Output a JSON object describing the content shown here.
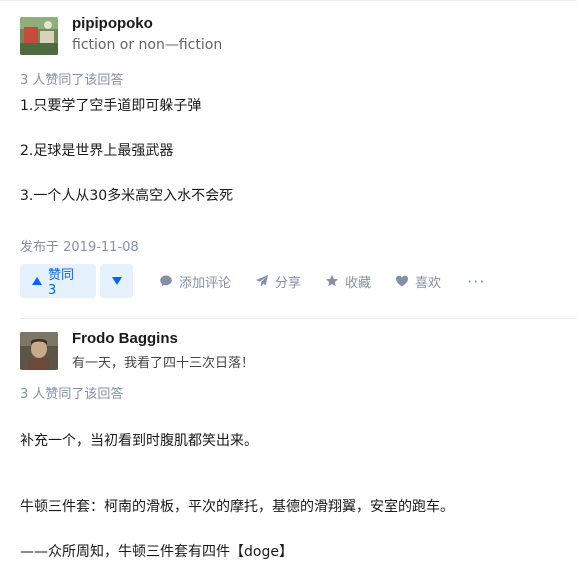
{
  "answers": [
    {
      "author": {
        "name": "pipipopoko",
        "bio": "fiction or non—fiction"
      },
      "votes_text": "3 人赞同了该回答",
      "paragraphs": [
        "1.只要学了空手道即可躲子弹",
        "2.足球是世界上最强武器",
        "3.一个人从30多米高空入水不会死"
      ],
      "published": "发布于 2019-11-08",
      "actions": {
        "upvote_label": "赞同 3",
        "comment_label": "添加评论",
        "share_label": "分享",
        "collect_label": "收藏",
        "like_label": "喜欢",
        "more_label": "···"
      }
    },
    {
      "author": {
        "name": "Frodo Baggins",
        "bio": "有一天，我看了四十三次日落！"
      },
      "votes_text": "3 人赞同了该回答",
      "paragraphs": [
        "补充一个，当初看到时腹肌都笑出来。",
        "牛顿三件套：柯南的滑板，平次的摩托，基德的滑翔翼，安室的跑车。",
        "——众所周知，牛顿三件套有四件【doge】"
      ]
    }
  ],
  "colors": {
    "accent": "#0066ff",
    "vote_bg": "#e5f1fd",
    "meta": "#8590a6"
  },
  "icons": [
    "triangle-up-icon",
    "triangle-down-icon",
    "comment-icon",
    "share-plane-icon",
    "star-icon",
    "heart-icon"
  ]
}
